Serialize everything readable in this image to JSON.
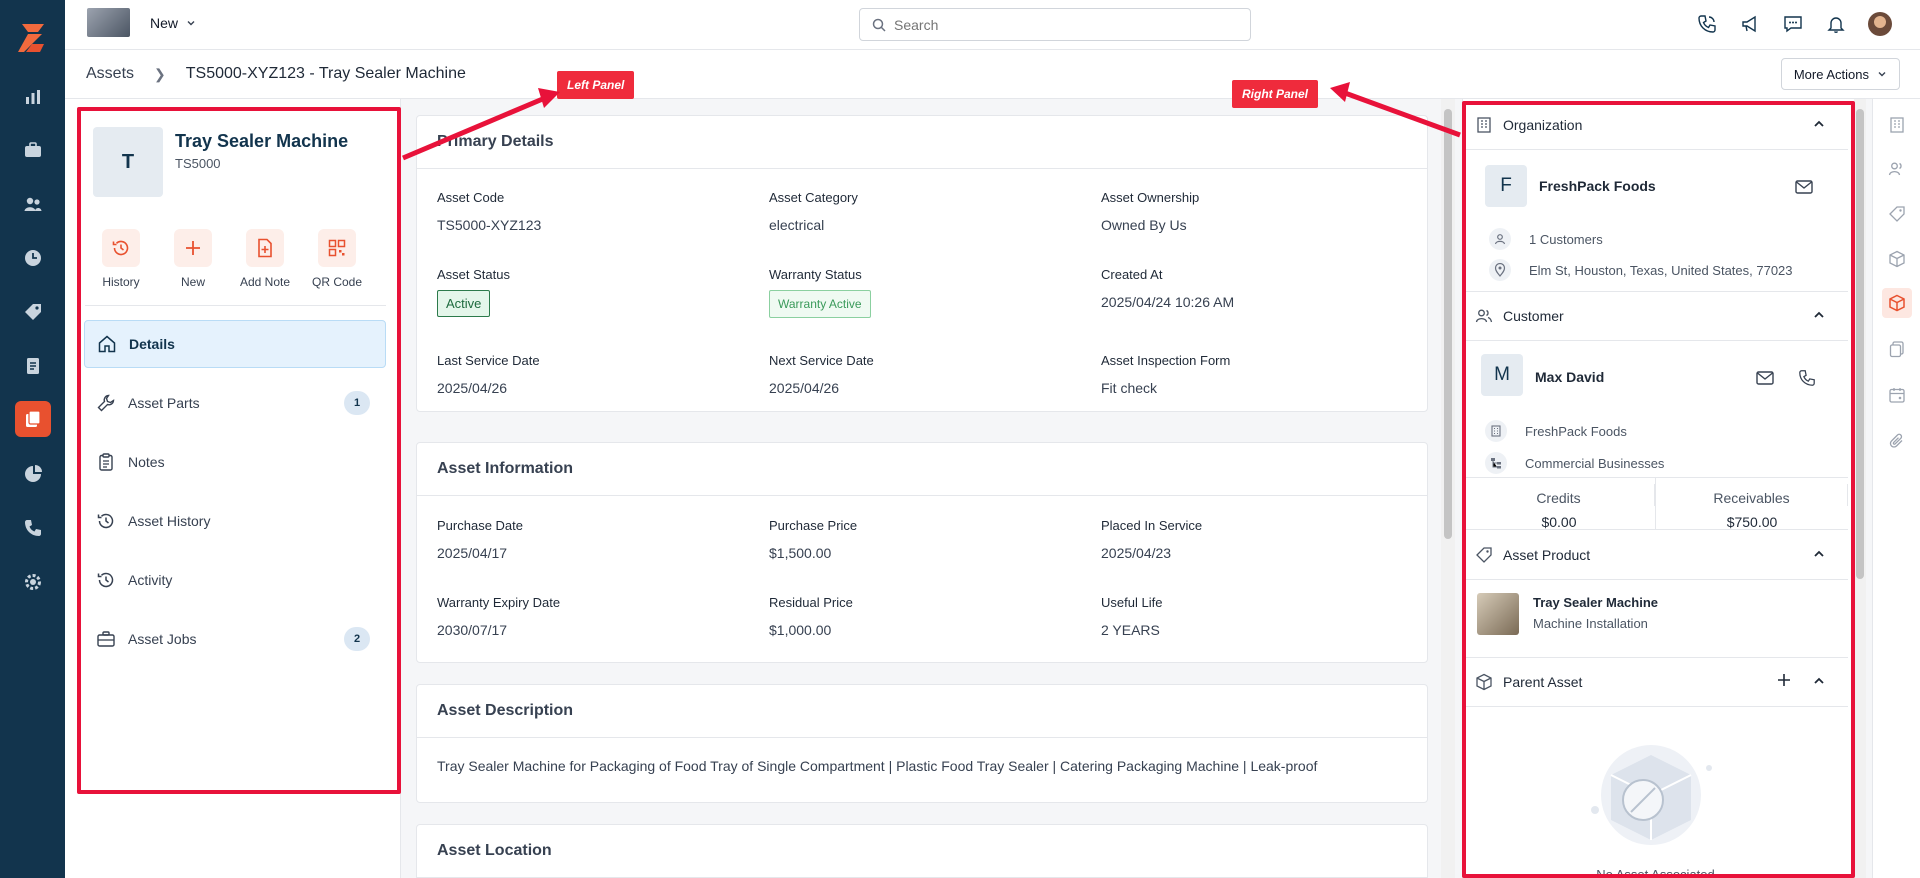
{
  "topbar": {
    "new_label": "New",
    "search_placeholder": "Search"
  },
  "breadcrumb": {
    "root": "Assets",
    "current": "TS5000-XYZ123 - Tray Sealer Machine"
  },
  "more_actions_label": "More Actions",
  "asset": {
    "initial": "T",
    "name": "Tray Sealer Machine",
    "code_short": "TS5000"
  },
  "quick_actions": [
    {
      "label": "History",
      "icon": "history-icon"
    },
    {
      "label": "New",
      "icon": "plus-icon"
    },
    {
      "label": "Add Note",
      "icon": "add-note-icon"
    },
    {
      "label": "QR Code",
      "icon": "qr-code-icon"
    }
  ],
  "menu": [
    {
      "label": "Details",
      "icon": "home-icon",
      "active": true
    },
    {
      "label": "Asset Parts",
      "icon": "wrench-icon",
      "badge": "1"
    },
    {
      "label": "Notes",
      "icon": "clipboard-icon"
    },
    {
      "label": "Asset History",
      "icon": "history-icon"
    },
    {
      "label": "Activity",
      "icon": "activity-icon"
    },
    {
      "label": "Asset Jobs",
      "icon": "briefcase-icon",
      "badge": "2"
    }
  ],
  "primary_details": {
    "title": "Primary Details",
    "asset_code_label": "Asset Code",
    "asset_code": "TS5000-XYZ123",
    "asset_category_label": "Asset Category",
    "asset_category": "electrical",
    "asset_ownership_label": "Asset Ownership",
    "asset_ownership": "Owned By Us",
    "asset_status_label": "Asset Status",
    "asset_status": "Active",
    "warranty_status_label": "Warranty Status",
    "warranty_status": "Warranty Active",
    "created_at_label": "Created At",
    "created_at": "2025/04/24 10:26 AM",
    "last_service_label": "Last Service Date",
    "last_service": "2025/04/26",
    "next_service_label": "Next Service Date",
    "next_service": "2025/04/26",
    "inspection_form_label": "Asset Inspection Form",
    "inspection_form": "Fit check"
  },
  "asset_information": {
    "title": "Asset Information",
    "purchase_date_label": "Purchase Date",
    "purchase_date": "2025/04/17",
    "purchase_price_label": "Purchase Price",
    "purchase_price": "$1,500.00",
    "placed_in_service_label": "Placed In Service",
    "placed_in_service": "2025/04/23",
    "warranty_expiry_label": "Warranty Expiry Date",
    "warranty_expiry": "2030/07/17",
    "residual_price_label": "Residual Price",
    "residual_price": "$1,000.00",
    "useful_life_label": "Useful Life",
    "useful_life": "2 YEARS"
  },
  "asset_description": {
    "title": "Asset Description",
    "text": "Tray Sealer Machine for Packaging of Food Tray of Single Compartment | Plastic Food Tray Sealer | Catering Packaging Machine | Leak-proof"
  },
  "asset_location": {
    "title": "Asset Location"
  },
  "organization": {
    "title": "Organization",
    "initial": "F",
    "name": "FreshPack Foods",
    "customers": "1 Customers",
    "address": "Elm St, Houston, Texas, United States, 77023"
  },
  "customer": {
    "title": "Customer",
    "initial": "M",
    "name": "Max David",
    "organization": "FreshPack Foods",
    "type": "Commercial Businesses",
    "credits_label": "Credits",
    "credits": "$0.00",
    "receivables_label": "Receivables",
    "receivables": "$750.00"
  },
  "asset_product": {
    "title": "Asset Product",
    "name": "Tray Sealer Machine",
    "sub": "Machine Installation"
  },
  "parent_asset": {
    "title": "Parent Asset",
    "empty": "No Asset Associated"
  },
  "annotations": {
    "left_label": "Left Panel",
    "right_label": "Right Panel"
  },
  "colors": {
    "rail": "#12344d",
    "accent": "#e8512f",
    "annotation": "#e8123a"
  }
}
